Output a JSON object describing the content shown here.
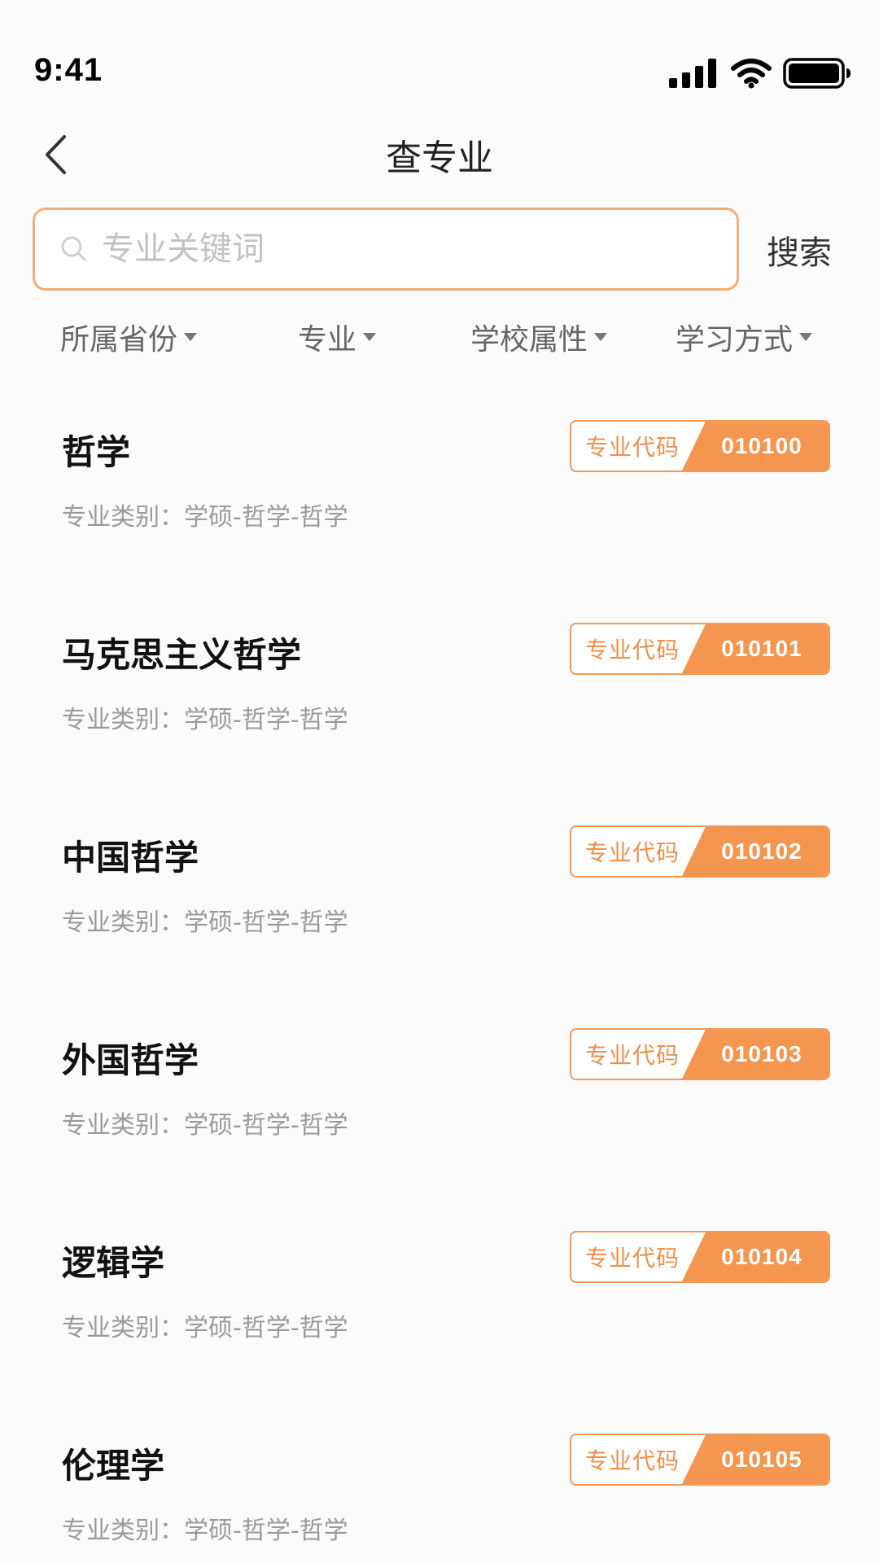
{
  "status_bar": {
    "time": "9:41"
  },
  "nav": {
    "title": "查专业"
  },
  "search": {
    "placeholder": "专业关键词",
    "value": "",
    "button_label": "搜索"
  },
  "filters": [
    {
      "label": "所属省份"
    },
    {
      "label": "专业"
    },
    {
      "label": "学校属性"
    },
    {
      "label": "学习方式"
    }
  ],
  "colors": {
    "accent": "#f59650",
    "accent_border": "#f2ad72",
    "muted_text": "#9a9a9a"
  },
  "majors": [
    {
      "name": "哲学",
      "code_label": "专业代码",
      "code": "010100",
      "category": "专业类别：学硕-哲学-哲学"
    },
    {
      "name": "马克思主义哲学",
      "code_label": "专业代码",
      "code": "010101",
      "category": "专业类别：学硕-哲学-哲学"
    },
    {
      "name": "中国哲学",
      "code_label": "专业代码",
      "code": "010102",
      "category": "专业类别：学硕-哲学-哲学"
    },
    {
      "name": "外国哲学",
      "code_label": "专业代码",
      "code": "010103",
      "category": "专业类别：学硕-哲学-哲学"
    },
    {
      "name": "逻辑学",
      "code_label": "专业代码",
      "code": "010104",
      "category": "专业类别：学硕-哲学-哲学"
    },
    {
      "name": "伦理学",
      "code_label": "专业代码",
      "code": "010105",
      "category": "专业类别：学硕-哲学-哲学"
    }
  ]
}
